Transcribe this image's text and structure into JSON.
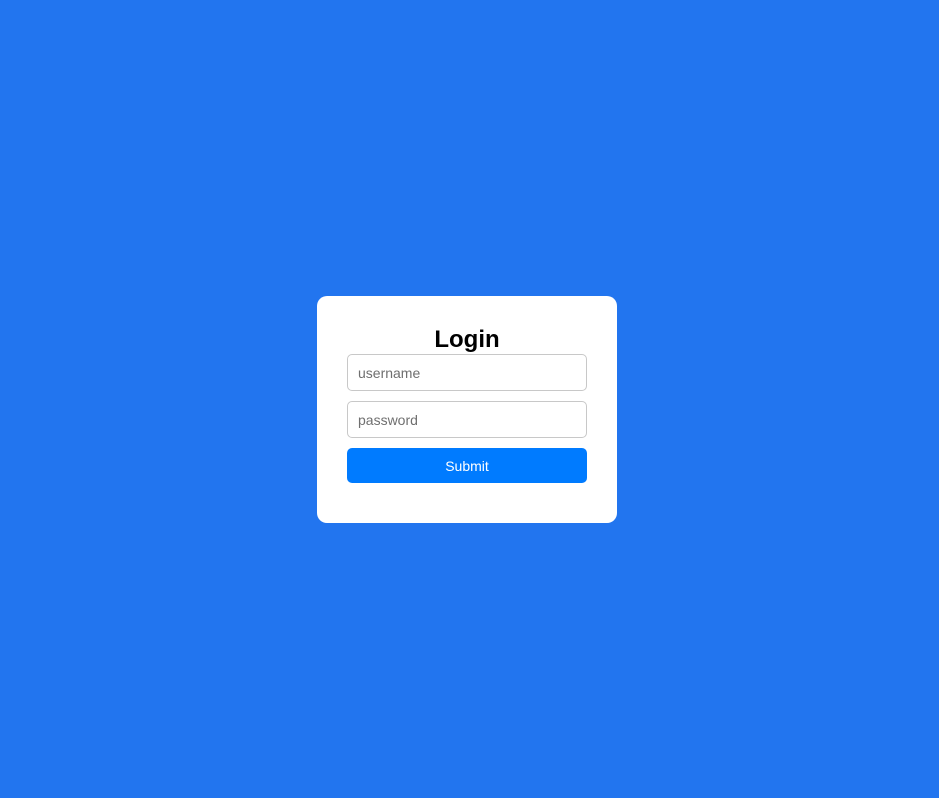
{
  "login_form": {
    "title": "Login",
    "username": {
      "value": "",
      "placeholder": "username"
    },
    "password": {
      "value": "",
      "placeholder": "password"
    },
    "submit_label": "Submit"
  },
  "colors": {
    "page_background": "#2275ef",
    "card_background": "#ffffff",
    "button_background": "#007bff",
    "button_text": "#ffffff"
  }
}
